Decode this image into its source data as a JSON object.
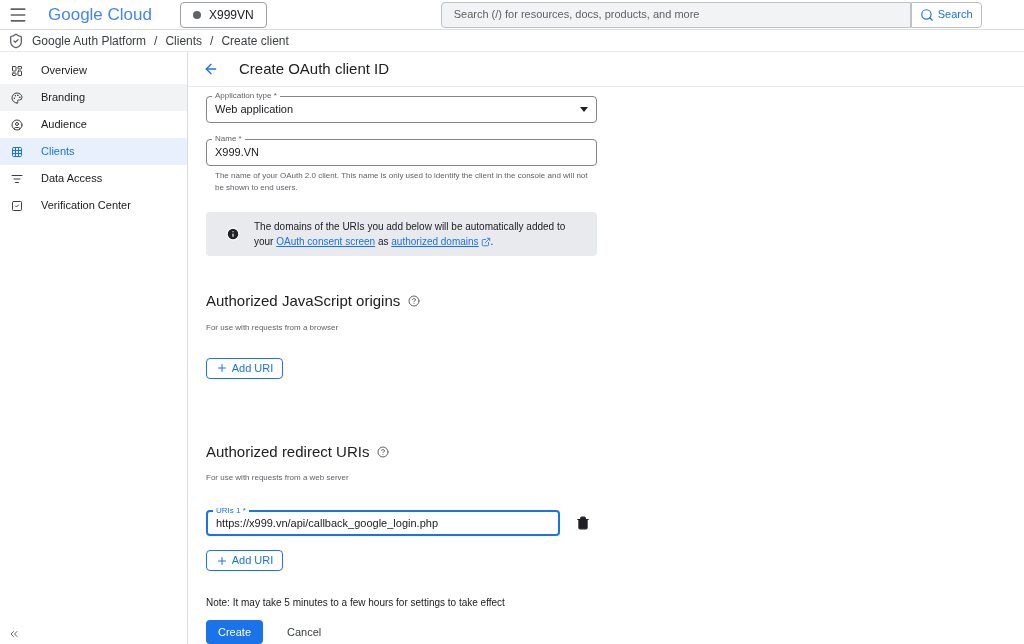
{
  "topbar": {
    "logo": "Google Cloud",
    "project": "X999VN",
    "search_placeholder": "Search (/) for resources, docs, products, and more",
    "search_button": "Search"
  },
  "breadcrumb": [
    {
      "label": "Google Auth Platform"
    },
    {
      "separator": "/",
      "label": "Clients"
    },
    {
      "separator": "/",
      "label": "Create client"
    }
  ],
  "sidebar": {
    "items": [
      {
        "label": "Overview",
        "selected": false,
        "hovered": false
      },
      {
        "label": "Branding",
        "selected": false,
        "hovered": true
      },
      {
        "label": "Audience",
        "selected": false,
        "hovered": false
      },
      {
        "label": "Clients",
        "selected": true,
        "hovered": false
      },
      {
        "label": "Data Access",
        "selected": false,
        "hovered": false
      },
      {
        "label": "Verification Center",
        "selected": false,
        "hovered": false
      }
    ]
  },
  "page": {
    "title": "Create OAuth client ID",
    "application_type": {
      "label": "Application type *",
      "value": "Web application"
    },
    "name": {
      "label": "Name *",
      "value": "X999.VN",
      "hint": "The name of your OAuth 2.0 client. This name is only used to identify the client in the console and will not be shown to end users."
    },
    "info": {
      "text_before": "The domains of the URIs you add below will be automatically added to your",
      "link_1": "OAuth consent screen",
      "text_middle": "as",
      "link_2": "authorized domains",
      "text_after": "."
    },
    "sections": [
      {
        "title": "Authorized JavaScript origins",
        "subtitle": "For use with requests from a browser",
        "add_button": "Add URI"
      },
      {
        "title": "Authorized redirect URIs",
        "subtitle": "For use with requests from a web server",
        "uris": [
          {
            "label": "URIs 1 *",
            "value": "https://x999.vn/api/callback_google_login.php",
            "focused": true
          }
        ],
        "add_button": "Add URI"
      }
    ],
    "note": "Note: It may take 5 minutes to a few hours for settings to take effect",
    "buttons": [
      {
        "label": "Create",
        "kind": "primary"
      },
      {
        "label": "Cancel",
        "kind": "text"
      }
    ]
  }
}
